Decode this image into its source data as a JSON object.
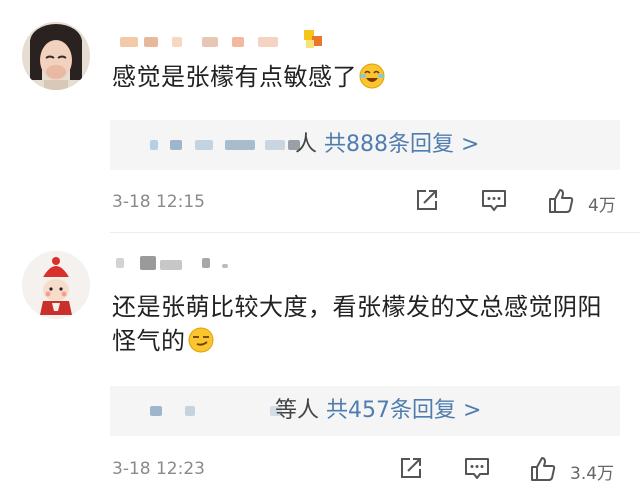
{
  "comments": [
    {
      "text": "感觉是张檬有点敏感了",
      "reply_suffix": "人",
      "reply_count": "共888条回复",
      "reply_arrow": ">",
      "time": "3-18 12:15",
      "likes": "4万"
    },
    {
      "text": "还是张萌比较大度，看张檬发的文总感觉阴阳怪气的",
      "reply_suffix": "等人",
      "reply_count": "共457条回复",
      "reply_arrow": ">",
      "time": "3-18 12:23",
      "likes": "3.4万"
    }
  ],
  "colors": {
    "link": "#507daf",
    "meta": "#8a8a8a",
    "reply_bg": "#f5f5f5"
  },
  "icons": [
    "share-icon",
    "comment-icon",
    "thumbs-up-icon",
    "laughing-crying-emoji",
    "smirk-emoji"
  ]
}
